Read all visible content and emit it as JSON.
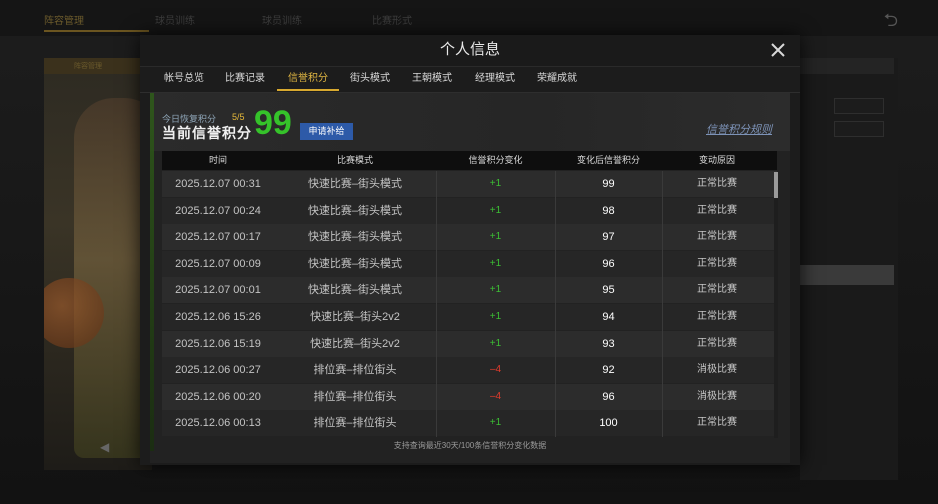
{
  "background": {
    "nav_tabs": [
      "阵容管理",
      "球员训练",
      "球员训练",
      "比赛形式"
    ],
    "left_panel_label": "阵容管理"
  },
  "modal": {
    "title": "个人信息",
    "tabs": [
      {
        "label": "帐号总览"
      },
      {
        "label": "比赛记录"
      },
      {
        "label": "信誉积分"
      },
      {
        "label": "街头模式"
      },
      {
        "label": "王朝模式"
      },
      {
        "label": "经理模式"
      },
      {
        "label": "荣耀成就"
      }
    ],
    "active_tab": "信誉积分"
  },
  "credit": {
    "restore_label": "今日恢复积分",
    "restore_count": "5/5",
    "current_label": "当前信誉积分",
    "score": "99",
    "supplement_button": "申请补给",
    "rules_link": "信誉积分规则"
  },
  "table": {
    "headers": [
      "时间",
      "比赛模式",
      "信誉积分变化",
      "变化后信誉积分",
      "变动原因"
    ],
    "rows": [
      {
        "time": "2025.12.07  00:31",
        "mode": "快速比赛–街头模式",
        "change": "+1",
        "after": "99",
        "reason": "正常比赛"
      },
      {
        "time": "2025.12.07  00:24",
        "mode": "快速比赛–街头模式",
        "change": "+1",
        "after": "98",
        "reason": "正常比赛"
      },
      {
        "time": "2025.12.07  00:17",
        "mode": "快速比赛–街头模式",
        "change": "+1",
        "after": "97",
        "reason": "正常比赛"
      },
      {
        "time": "2025.12.07  00:09",
        "mode": "快速比赛–街头模式",
        "change": "+1",
        "after": "96",
        "reason": "正常比赛"
      },
      {
        "time": "2025.12.07  00:01",
        "mode": "快速比赛–街头模式",
        "change": "+1",
        "after": "95",
        "reason": "正常比赛"
      },
      {
        "time": "2025.12.06  15:26",
        "mode": "快速比赛–街头2v2",
        "change": "+1",
        "after": "94",
        "reason": "正常比赛"
      },
      {
        "time": "2025.12.06  15:19",
        "mode": "快速比赛–街头2v2",
        "change": "+1",
        "after": "93",
        "reason": "正常比赛"
      },
      {
        "time": "2025.12.06  00:27",
        "mode": "排位赛–排位街头",
        "change": "–4",
        "after": "92",
        "reason": "消极比赛"
      },
      {
        "time": "2025.12.06  00:20",
        "mode": "排位赛–排位街头",
        "change": "–4",
        "after": "96",
        "reason": "消极比赛"
      },
      {
        "time": "2025.12.06  00:13",
        "mode": "排位赛–排位街头",
        "change": "+1",
        "after": "100",
        "reason": "正常比赛"
      }
    ],
    "footer_note": "支持查询最近30天/100条信誉积分变化数据"
  },
  "colors": {
    "accent": "#e0b642",
    "positive": "#3cbf34",
    "negative": "#e03b2c",
    "score": "#35c22a",
    "button": "#2d5aa8"
  }
}
